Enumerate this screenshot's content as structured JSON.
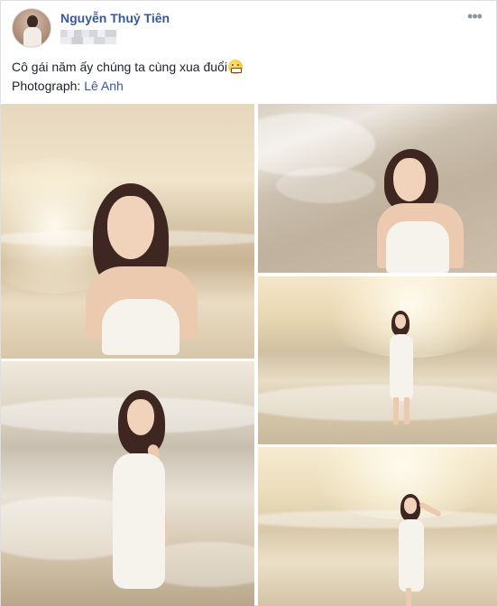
{
  "post": {
    "author": "Nguyễn Thuỷ Tiên",
    "more_label": "•••",
    "caption": "Cô gái năm ấy chúng ta cùng xua đuổi",
    "caption_emoji": "grinning-face-emoji",
    "credit_label": "Photograph:",
    "credit_name": "Lê Anh"
  },
  "photos": [
    {
      "alt": "Woman in white dress sitting on the beach at sunset"
    },
    {
      "alt": "Woman in white dress sitting by the waves"
    },
    {
      "alt": "Woman in white dress walking in the sea"
    },
    {
      "alt": "Woman in white dress kneeling in the surf"
    },
    {
      "alt": "Woman in white dress walking in the sea with hand raised"
    }
  ],
  "colors": {
    "author_link": "#385898",
    "text": "#1d2129",
    "link": "#365899",
    "border": "#dddfe2",
    "icon_gray": "#90949c"
  }
}
